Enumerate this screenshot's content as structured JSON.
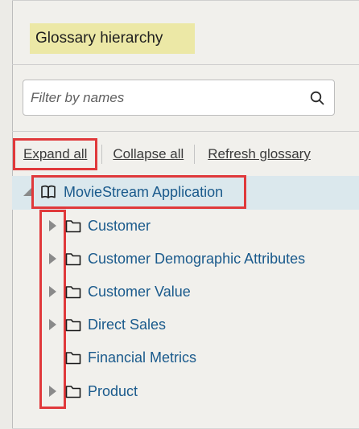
{
  "panel": {
    "title": "Glossary hierarchy"
  },
  "search": {
    "placeholder": "Filter by names",
    "value": "",
    "icon": "search-icon"
  },
  "toolbar": {
    "expand_all": "Expand all",
    "collapse_all": "Collapse all",
    "refresh": "Refresh glossary"
  },
  "tree": {
    "root": {
      "label": "MovieStream Application",
      "icon": "book-icon",
      "expanded": true
    },
    "children": [
      {
        "label": "Customer",
        "icon": "folder-icon",
        "has_toggle": true
      },
      {
        "label": "Customer Demographic Attributes",
        "icon": "folder-icon",
        "has_toggle": true
      },
      {
        "label": "Customer Value",
        "icon": "folder-icon",
        "has_toggle": true
      },
      {
        "label": "Direct Sales",
        "icon": "folder-icon",
        "has_toggle": true
      },
      {
        "label": "Financial Metrics",
        "icon": "folder-icon",
        "has_toggle": false
      },
      {
        "label": "Product",
        "icon": "folder-icon",
        "has_toggle": true
      }
    ]
  },
  "colors": {
    "title_highlight": "#ece8a6",
    "link": "#1a5a8c",
    "selected_row": "#dbe8ed",
    "annotation_red": "#e0393b"
  }
}
